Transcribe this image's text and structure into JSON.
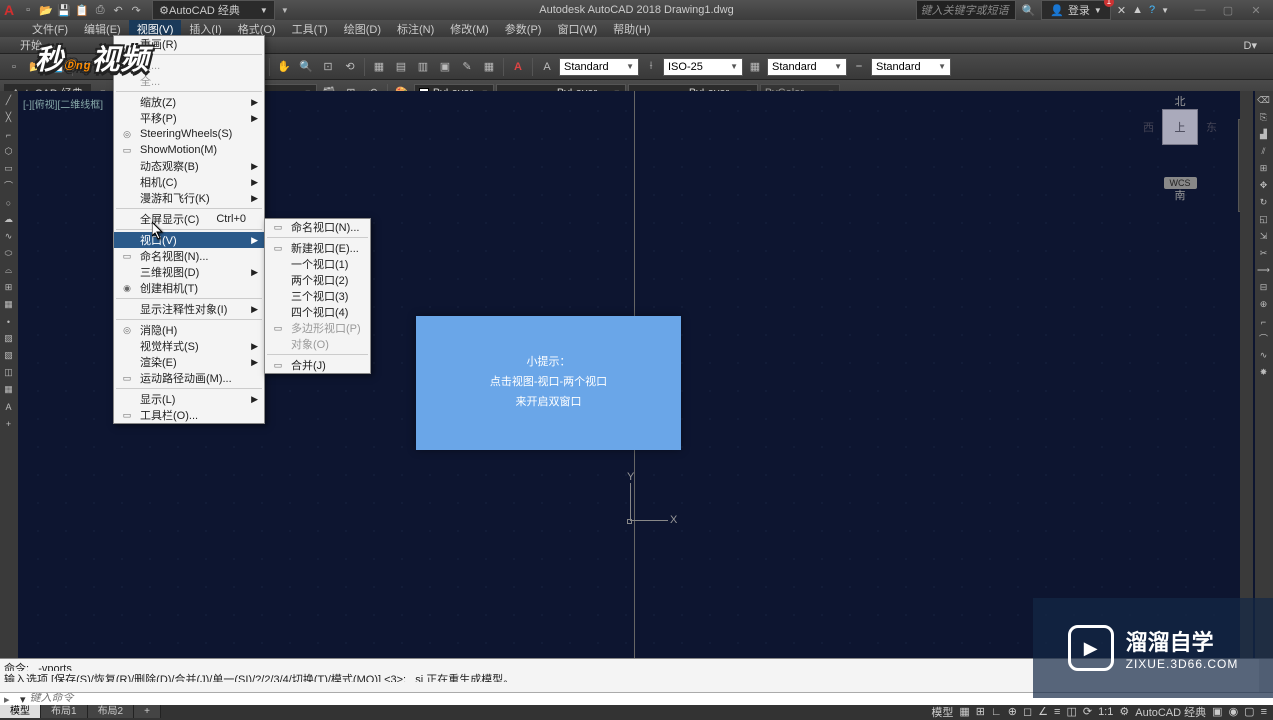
{
  "title": "Autodesk AutoCAD 2018   Drawing1.dwg",
  "workspace": "AutoCAD 经典",
  "search_placeholder": "键入关键字或短语",
  "login": "登录",
  "menus": [
    "文件(F)",
    "编辑(E)",
    "视图(V)",
    "插入(I)",
    "格式(O)",
    "工具(T)",
    "绘图(D)",
    "标注(N)",
    "修改(M)",
    "参数(P)",
    "窗口(W)",
    "帮助(H)"
  ],
  "ribbon_tab": "开始",
  "style_dropdowns": {
    "text": "Standard",
    "dim": "ISO-25",
    "tbl": "Standard",
    "ml": "Standard"
  },
  "layer": {
    "color_dd": "ByLayer",
    "line_dd": "ByLayer",
    "lw_dd": "ByLayer",
    "plot_dd": "ByColor"
  },
  "autocad_label": "AutoCAD 经典",
  "viewport_label": "[-][俯视][二维线框]",
  "viewcube": {
    "n": "北",
    "s": "南",
    "e": "东",
    "w": "西",
    "top": "上",
    "wcs": "WCS"
  },
  "ucs": {
    "x": "X",
    "y": "Y"
  },
  "tooltip": {
    "l1": "小提示：",
    "l2": "点击视图-视口-两个视口",
    "l3": "来开启双窗口"
  },
  "view_menu": [
    {
      "label": "重画(R)"
    },
    {
      "sep": true
    },
    {
      "label": "重...",
      "disabled": true
    },
    {
      "label": "全...",
      "disabled": true
    },
    {
      "sep": true
    },
    {
      "label": "缩放(Z)",
      "sub": true
    },
    {
      "label": "平移(P)",
      "sub": true
    },
    {
      "label": "SteeringWheels(S)",
      "icon": "◎"
    },
    {
      "label": "ShowMotion(M)",
      "icon": "▭"
    },
    {
      "label": "动态观察(B)",
      "sub": true
    },
    {
      "label": "相机(C)",
      "sub": true
    },
    {
      "label": "漫游和飞行(K)",
      "sub": true
    },
    {
      "sep": true
    },
    {
      "label": "全屏显示(C)",
      "shortcut": "Ctrl+0"
    },
    {
      "sep": true
    },
    {
      "label": "视口(V)",
      "sub": true,
      "active": true
    },
    {
      "label": "命名视图(N)...",
      "icon": "▭"
    },
    {
      "label": "三维视图(D)",
      "sub": true
    },
    {
      "label": "创建相机(T)",
      "icon": "◉"
    },
    {
      "sep": true
    },
    {
      "label": "显示注释性对象(I)",
      "sub": true
    },
    {
      "sep": true
    },
    {
      "label": "消隐(H)",
      "icon": "◎"
    },
    {
      "label": "视觉样式(S)",
      "sub": true
    },
    {
      "label": "渲染(E)",
      "sub": true
    },
    {
      "label": "运动路径动画(M)...",
      "icon": "▭"
    },
    {
      "sep": true
    },
    {
      "label": "显示(L)",
      "sub": true
    },
    {
      "label": "工具栏(O)...",
      "icon": "▭"
    }
  ],
  "viewport_submenu": [
    {
      "label": "命名视口(N)...",
      "icon": "▭"
    },
    {
      "sep": true
    },
    {
      "label": "新建视口(E)...",
      "icon": "▭"
    },
    {
      "label": "一个视口(1)"
    },
    {
      "label": "两个视口(2)"
    },
    {
      "label": "三个视口(3)"
    },
    {
      "label": "四个视口(4)"
    },
    {
      "label": "多边形视口(P)",
      "icon": "▭",
      "disabled": true
    },
    {
      "label": "对象(O)",
      "disabled": true
    },
    {
      "sep": true
    },
    {
      "label": "合并(J)",
      "icon": "▭"
    }
  ],
  "cmd": {
    "l1": "命令: _-vports",
    "l2": "输入选项 [保存(S)/恢复(R)/删除(D)/合并(J)/单一(SI)/?/2/3/4/切换(T)/模式(MO)] <3>: _si 正在重生成模型。",
    "prompt": "键入命令"
  },
  "tabs": {
    "model": "模型",
    "l1": "布局1",
    "l2": "布局2"
  },
  "status": {
    "model": "模型",
    "scale": "1:1",
    "ws": "AutoCAD 经典"
  },
  "brand": {
    "name": "溜溜自学",
    "url": "ZIXUE.3D66.COM"
  }
}
